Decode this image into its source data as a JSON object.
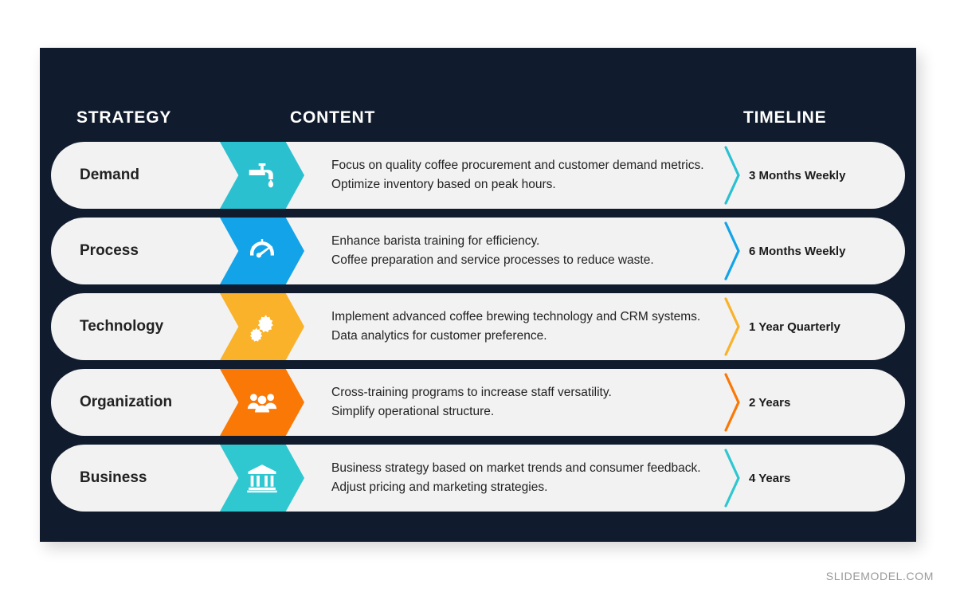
{
  "slide": {
    "background_color": "#ffffff",
    "panel_color": "#101c2e",
    "row_color": "#f2f2f2",
    "watermark": "SLIDEMODEL.COM"
  },
  "headers": {
    "strategy": "STRATEGY",
    "content": "CONTENT",
    "timeline": "TIMELINE"
  },
  "rows": [
    {
      "strategy": "Demand",
      "icon": "faucet-icon",
      "accent": "#2bc0d0",
      "content_line1": "Focus on quality coffee procurement and customer demand metrics.",
      "content_line2": "Optimize inventory based on peak hours.",
      "timeline": "3 Months Weekly"
    },
    {
      "strategy": "Process",
      "icon": "gauge-icon",
      "accent": "#12a3e8",
      "content_line1": "Enhance barista training for efficiency.",
      "content_line2": "Coffee preparation and service processes to reduce waste.",
      "timeline": "6 Months Weekly"
    },
    {
      "strategy": "Technology",
      "icon": "gears-icon",
      "accent": "#f9b22a",
      "content_line1": "Implement advanced coffee brewing technology and CRM systems.",
      "content_line2": "Data analytics for customer preference.",
      "timeline": "1 Year Quarterly"
    },
    {
      "strategy": "Organization",
      "icon": "people-group-icon",
      "accent": "#fa7806",
      "content_line1": "Cross-training programs to increase staff versatility.",
      "content_line2": "Simplify operational structure.",
      "timeline": "2 Years"
    },
    {
      "strategy": "Business",
      "icon": "bank-building-icon",
      "accent": "#2fc7d0",
      "content_line1": "Business strategy based on market trends and consumer feedback.",
      "content_line2": "Adjust pricing and marketing strategies.",
      "timeline": "4 Years"
    }
  ]
}
